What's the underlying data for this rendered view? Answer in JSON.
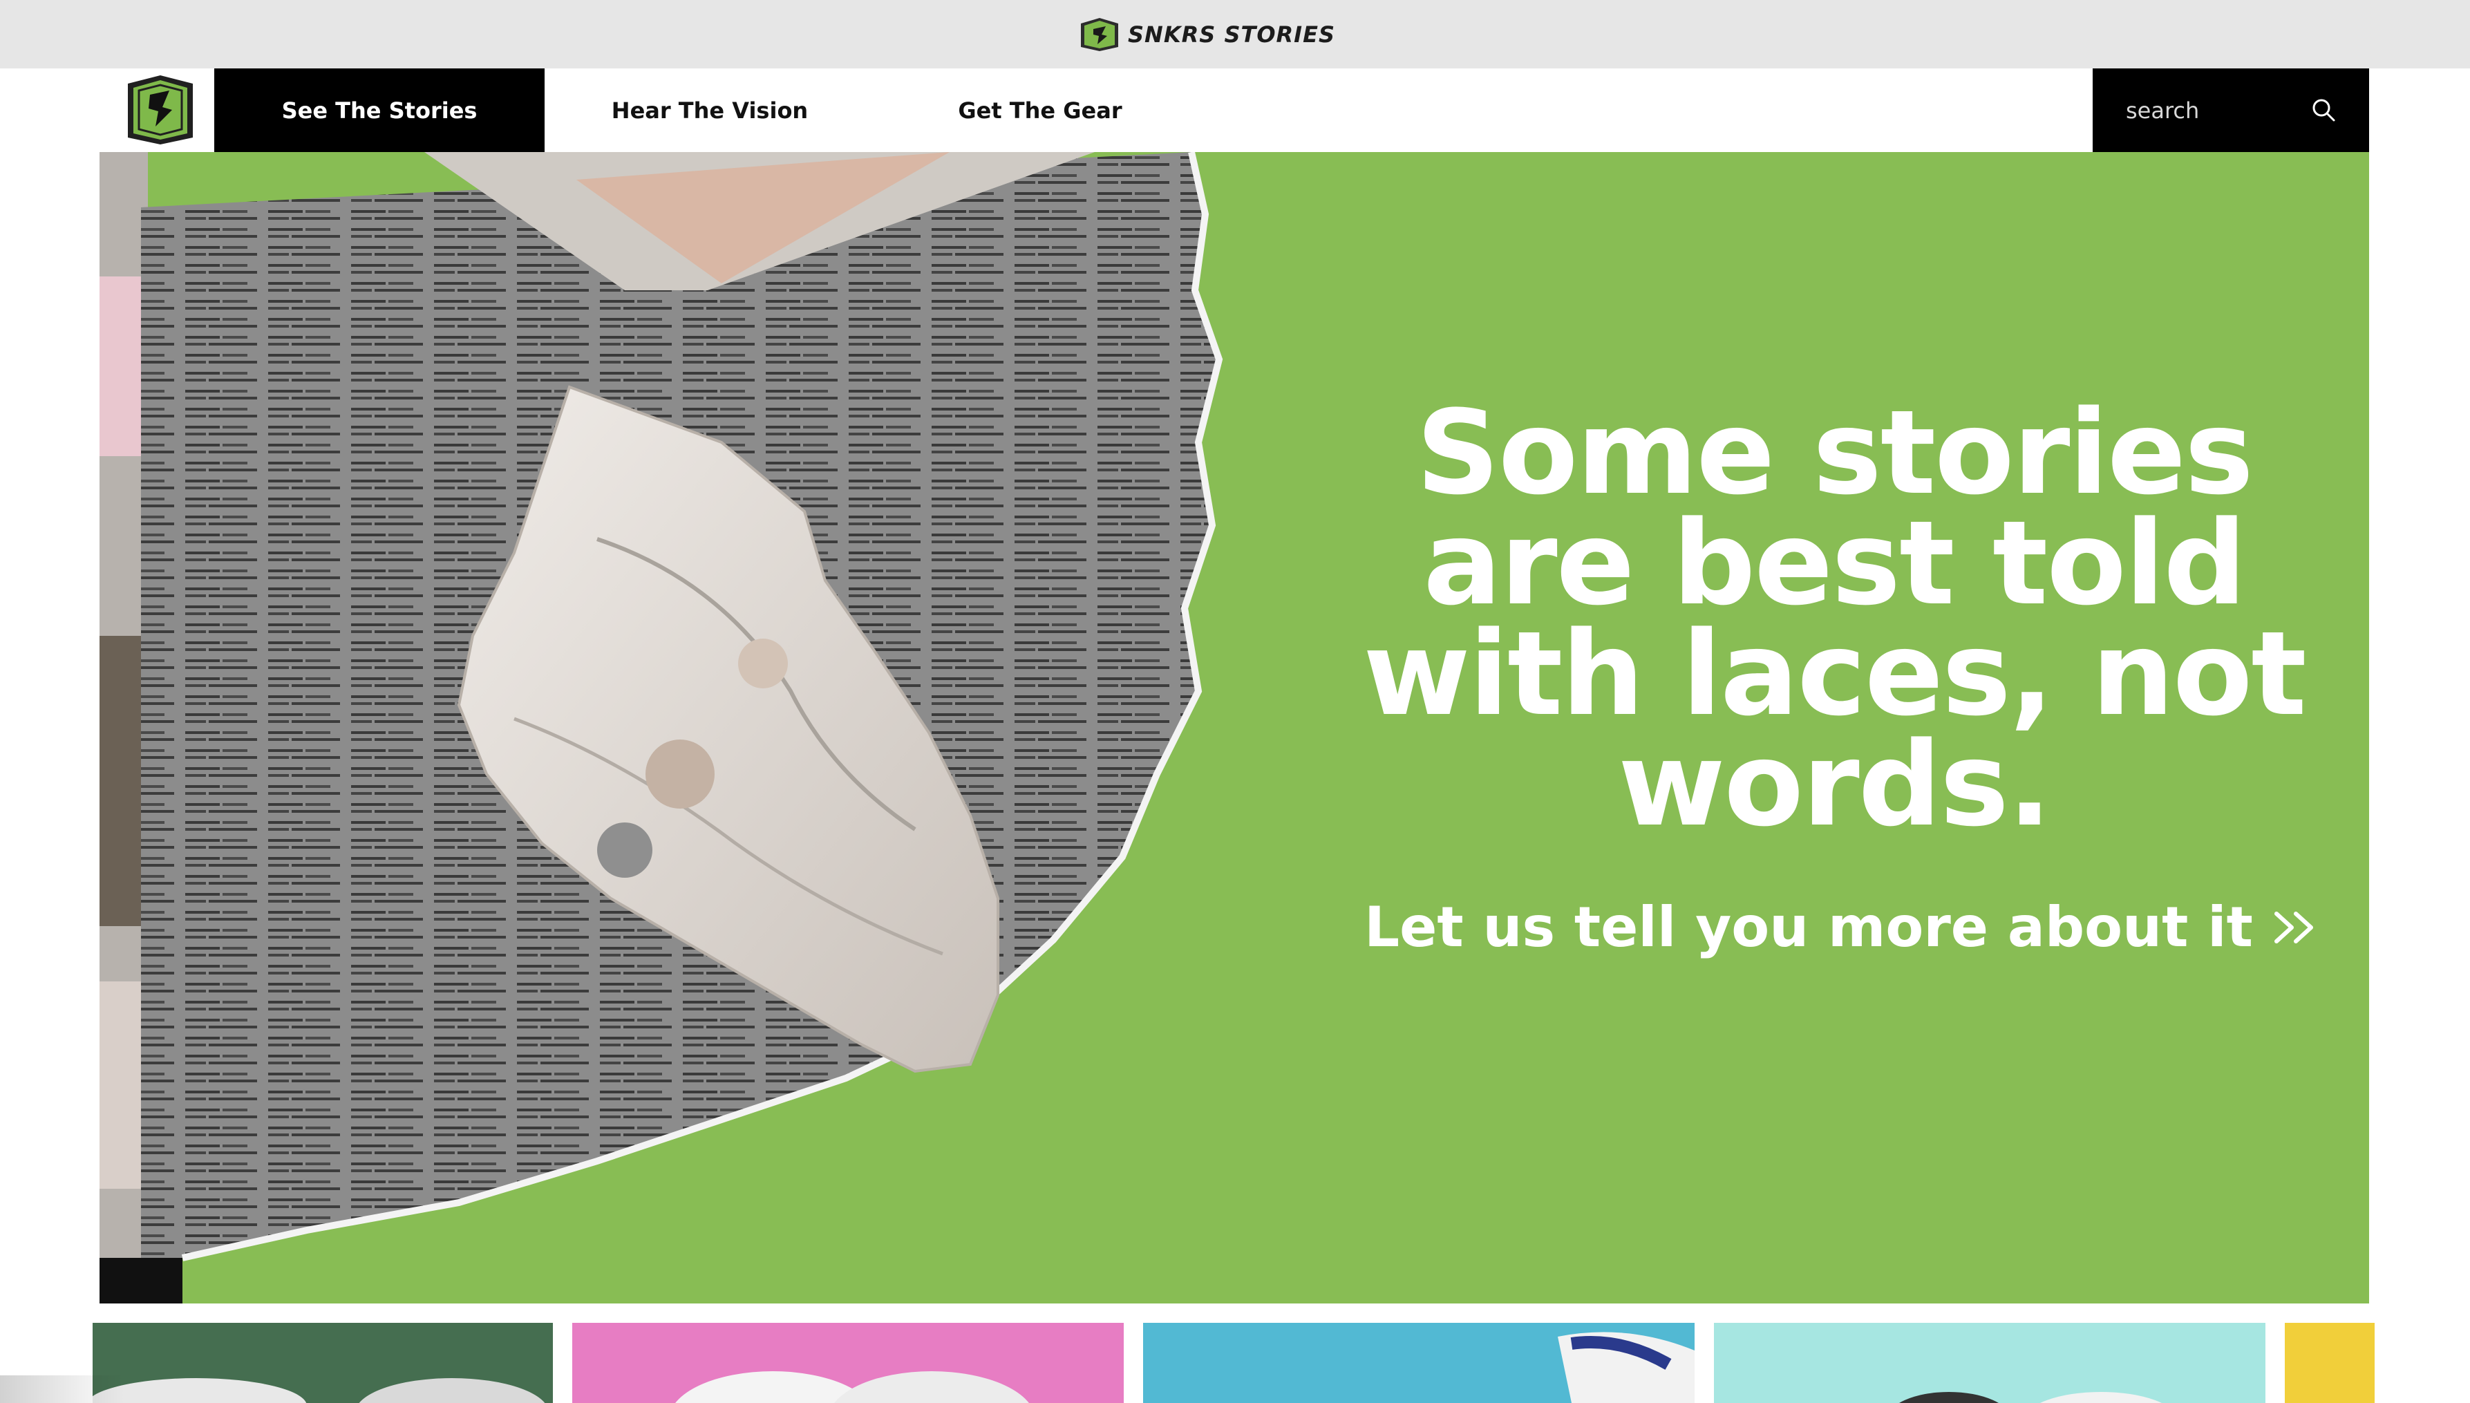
{
  "brand": {
    "name": "SNKRS STORIES"
  },
  "nav": {
    "items": [
      {
        "label": "See The Stories",
        "active": true
      },
      {
        "label": "Hear The Vision",
        "active": false
      },
      {
        "label": "Get The Gear",
        "active": false
      }
    ]
  },
  "search": {
    "placeholder": "search",
    "value": ""
  },
  "hero": {
    "headline": "Some stories are best told with laces, not words.",
    "cta_label": "Let us tell you more about it"
  },
  "colors": {
    "accent_green": "#88bd54",
    "nav_active": "#000000",
    "tile_colors": [
      "#456e50",
      "#e77dc3",
      "#52b9d3",
      "#a6e6e1",
      "#f1cf3a"
    ]
  },
  "icons": [
    "logo-badge-icon",
    "search-icon",
    "double-chevron-right-icon"
  ]
}
